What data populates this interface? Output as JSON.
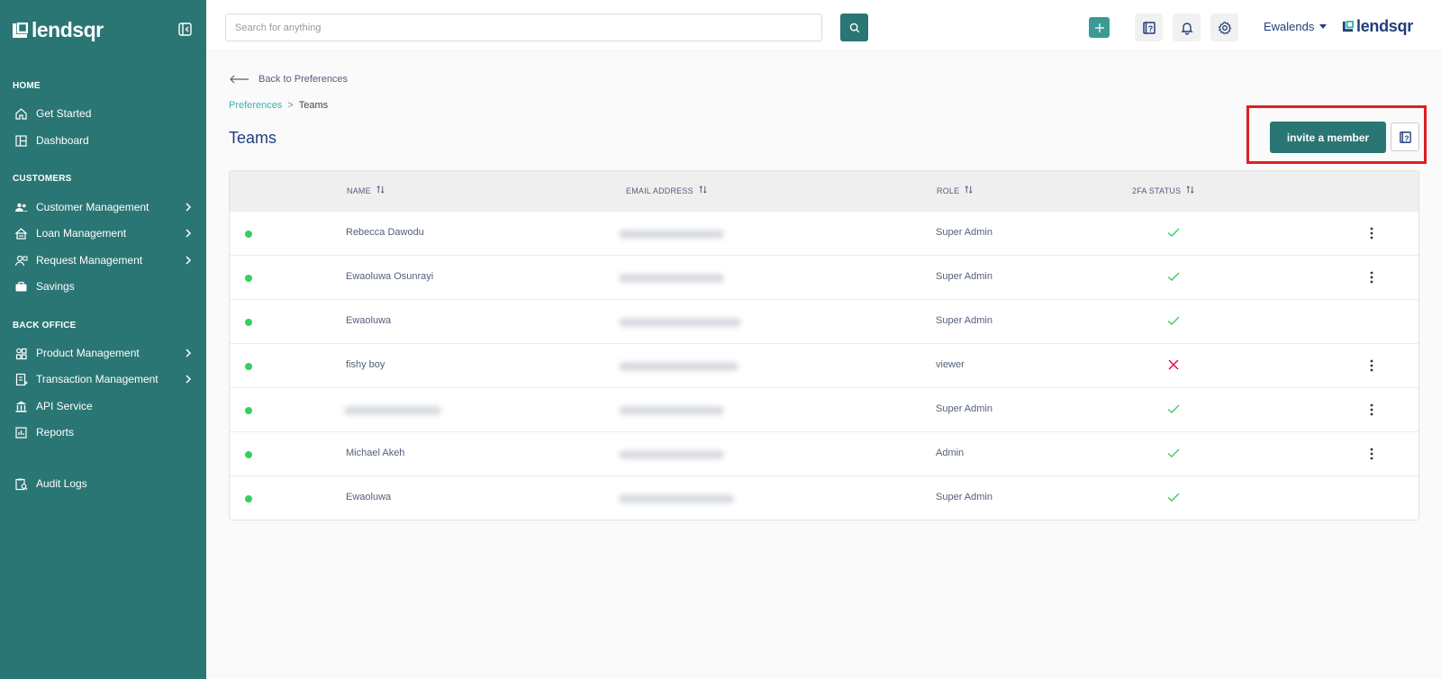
{
  "brand": {
    "name": "lendsqr"
  },
  "sidebar": {
    "sections": [
      {
        "label": "HOME",
        "items": [
          {
            "label": "Get Started",
            "icon": "home-icon",
            "chevron": false
          },
          {
            "label": "Dashboard",
            "icon": "dashboard-icon",
            "chevron": false
          }
        ]
      },
      {
        "label": "CUSTOMERS",
        "items": [
          {
            "label": "Customer Management",
            "icon": "users-icon",
            "chevron": true
          },
          {
            "label": "Loan Management",
            "icon": "loan-icon",
            "chevron": true
          },
          {
            "label": "Request Management",
            "icon": "request-icon",
            "chevron": true
          },
          {
            "label": "Savings",
            "icon": "briefcase-icon",
            "chevron": false
          }
        ]
      },
      {
        "label": "BACK OFFICE",
        "items": [
          {
            "label": "Product Management",
            "icon": "product-icon",
            "chevron": true
          },
          {
            "label": "Transaction Management",
            "icon": "transaction-icon",
            "chevron": true
          },
          {
            "label": "API Service",
            "icon": "bank-icon",
            "chevron": false
          },
          {
            "label": "Reports",
            "icon": "chart-icon",
            "chevron": false
          }
        ]
      },
      {
        "label": "",
        "items": [
          {
            "label": "Audit Logs",
            "icon": "audit-icon",
            "chevron": false
          }
        ]
      }
    ]
  },
  "topbar": {
    "search_placeholder": "Search for anything",
    "search_value": "",
    "user_name": "Ewalends",
    "brand_name": "lendsqr"
  },
  "content": {
    "back_label": "Back to Preferences",
    "breadcrumb": {
      "parent": "Preferences",
      "separator": ">",
      "current": "Teams"
    },
    "title": "Teams",
    "invite_label": "invite a member"
  },
  "table": {
    "headers": {
      "name": "NAME",
      "email": "EMAIL ADDRESS",
      "role": "ROLE",
      "twofa": "2FA STATUS"
    },
    "rows": [
      {
        "name": "Rebecca Dawodu",
        "role": "Super Admin",
        "twofa": true,
        "menu": true
      },
      {
        "name": "Ewaoluwa Osunrayi",
        "role": "Super Admin",
        "twofa": true,
        "menu": true
      },
      {
        "name": "Ewaoluwa",
        "role": "Super Admin",
        "twofa": true,
        "menu": false
      },
      {
        "name": "fishy boy",
        "role": "viewer",
        "twofa": false,
        "menu": true
      },
      {
        "name": "",
        "role": "Super Admin",
        "twofa": true,
        "menu": true
      },
      {
        "name": "Michael Akeh",
        "role": "Admin",
        "twofa": true,
        "menu": true
      },
      {
        "name": "Ewaoluwa",
        "role": "Super Admin",
        "twofa": true,
        "menu": false
      }
    ]
  },
  "colors": {
    "sidebar_bg": "#2a7674",
    "title_blue": "#213f7d",
    "accent_teal": "#39b5ad",
    "active_dot": "#39cd62",
    "check_green": "#39cd62",
    "cross_red": "#e4033b",
    "highlight_red": "#e01f1f"
  }
}
